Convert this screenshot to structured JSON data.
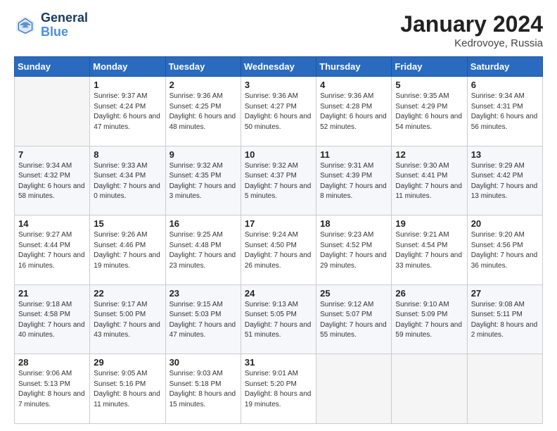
{
  "header": {
    "logo_line1": "General",
    "logo_line2": "Blue",
    "month_title": "January 2024",
    "location": "Kedrovoye, Russia"
  },
  "weekdays": [
    "Sunday",
    "Monday",
    "Tuesday",
    "Wednesday",
    "Thursday",
    "Friday",
    "Saturday"
  ],
  "weeks": [
    [
      {
        "day": "",
        "sunrise": "",
        "sunset": "",
        "daylight": ""
      },
      {
        "day": "1",
        "sunrise": "Sunrise: 9:37 AM",
        "sunset": "Sunset: 4:24 PM",
        "daylight": "Daylight: 6 hours and 47 minutes."
      },
      {
        "day": "2",
        "sunrise": "Sunrise: 9:36 AM",
        "sunset": "Sunset: 4:25 PM",
        "daylight": "Daylight: 6 hours and 48 minutes."
      },
      {
        "day": "3",
        "sunrise": "Sunrise: 9:36 AM",
        "sunset": "Sunset: 4:27 PM",
        "daylight": "Daylight: 6 hours and 50 minutes."
      },
      {
        "day": "4",
        "sunrise": "Sunrise: 9:36 AM",
        "sunset": "Sunset: 4:28 PM",
        "daylight": "Daylight: 6 hours and 52 minutes."
      },
      {
        "day": "5",
        "sunrise": "Sunrise: 9:35 AM",
        "sunset": "Sunset: 4:29 PM",
        "daylight": "Daylight: 6 hours and 54 minutes."
      },
      {
        "day": "6",
        "sunrise": "Sunrise: 9:34 AM",
        "sunset": "Sunset: 4:31 PM",
        "daylight": "Daylight: 6 hours and 56 minutes."
      }
    ],
    [
      {
        "day": "7",
        "sunrise": "Sunrise: 9:34 AM",
        "sunset": "Sunset: 4:32 PM",
        "daylight": "Daylight: 6 hours and 58 minutes."
      },
      {
        "day": "8",
        "sunrise": "Sunrise: 9:33 AM",
        "sunset": "Sunset: 4:34 PM",
        "daylight": "Daylight: 7 hours and 0 minutes."
      },
      {
        "day": "9",
        "sunrise": "Sunrise: 9:32 AM",
        "sunset": "Sunset: 4:35 PM",
        "daylight": "Daylight: 7 hours and 3 minutes."
      },
      {
        "day": "10",
        "sunrise": "Sunrise: 9:32 AM",
        "sunset": "Sunset: 4:37 PM",
        "daylight": "Daylight: 7 hours and 5 minutes."
      },
      {
        "day": "11",
        "sunrise": "Sunrise: 9:31 AM",
        "sunset": "Sunset: 4:39 PM",
        "daylight": "Daylight: 7 hours and 8 minutes."
      },
      {
        "day": "12",
        "sunrise": "Sunrise: 9:30 AM",
        "sunset": "Sunset: 4:41 PM",
        "daylight": "Daylight: 7 hours and 11 minutes."
      },
      {
        "day": "13",
        "sunrise": "Sunrise: 9:29 AM",
        "sunset": "Sunset: 4:42 PM",
        "daylight": "Daylight: 7 hours and 13 minutes."
      }
    ],
    [
      {
        "day": "14",
        "sunrise": "Sunrise: 9:27 AM",
        "sunset": "Sunset: 4:44 PM",
        "daylight": "Daylight: 7 hours and 16 minutes."
      },
      {
        "day": "15",
        "sunrise": "Sunrise: 9:26 AM",
        "sunset": "Sunset: 4:46 PM",
        "daylight": "Daylight: 7 hours and 19 minutes."
      },
      {
        "day": "16",
        "sunrise": "Sunrise: 9:25 AM",
        "sunset": "Sunset: 4:48 PM",
        "daylight": "Daylight: 7 hours and 23 minutes."
      },
      {
        "day": "17",
        "sunrise": "Sunrise: 9:24 AM",
        "sunset": "Sunset: 4:50 PM",
        "daylight": "Daylight: 7 hours and 26 minutes."
      },
      {
        "day": "18",
        "sunrise": "Sunrise: 9:23 AM",
        "sunset": "Sunset: 4:52 PM",
        "daylight": "Daylight: 7 hours and 29 minutes."
      },
      {
        "day": "19",
        "sunrise": "Sunrise: 9:21 AM",
        "sunset": "Sunset: 4:54 PM",
        "daylight": "Daylight: 7 hours and 33 minutes."
      },
      {
        "day": "20",
        "sunrise": "Sunrise: 9:20 AM",
        "sunset": "Sunset: 4:56 PM",
        "daylight": "Daylight: 7 hours and 36 minutes."
      }
    ],
    [
      {
        "day": "21",
        "sunrise": "Sunrise: 9:18 AM",
        "sunset": "Sunset: 4:58 PM",
        "daylight": "Daylight: 7 hours and 40 minutes."
      },
      {
        "day": "22",
        "sunrise": "Sunrise: 9:17 AM",
        "sunset": "Sunset: 5:00 PM",
        "daylight": "Daylight: 7 hours and 43 minutes."
      },
      {
        "day": "23",
        "sunrise": "Sunrise: 9:15 AM",
        "sunset": "Sunset: 5:03 PM",
        "daylight": "Daylight: 7 hours and 47 minutes."
      },
      {
        "day": "24",
        "sunrise": "Sunrise: 9:13 AM",
        "sunset": "Sunset: 5:05 PM",
        "daylight": "Daylight: 7 hours and 51 minutes."
      },
      {
        "day": "25",
        "sunrise": "Sunrise: 9:12 AM",
        "sunset": "Sunset: 5:07 PM",
        "daylight": "Daylight: 7 hours and 55 minutes."
      },
      {
        "day": "26",
        "sunrise": "Sunrise: 9:10 AM",
        "sunset": "Sunset: 5:09 PM",
        "daylight": "Daylight: 7 hours and 59 minutes."
      },
      {
        "day": "27",
        "sunrise": "Sunrise: 9:08 AM",
        "sunset": "Sunset: 5:11 PM",
        "daylight": "Daylight: 8 hours and 2 minutes."
      }
    ],
    [
      {
        "day": "28",
        "sunrise": "Sunrise: 9:06 AM",
        "sunset": "Sunset: 5:13 PM",
        "daylight": "Daylight: 8 hours and 7 minutes."
      },
      {
        "day": "29",
        "sunrise": "Sunrise: 9:05 AM",
        "sunset": "Sunset: 5:16 PM",
        "daylight": "Daylight: 8 hours and 11 minutes."
      },
      {
        "day": "30",
        "sunrise": "Sunrise: 9:03 AM",
        "sunset": "Sunset: 5:18 PM",
        "daylight": "Daylight: 8 hours and 15 minutes."
      },
      {
        "day": "31",
        "sunrise": "Sunrise: 9:01 AM",
        "sunset": "Sunset: 5:20 PM",
        "daylight": "Daylight: 8 hours and 19 minutes."
      },
      {
        "day": "",
        "sunrise": "",
        "sunset": "",
        "daylight": ""
      },
      {
        "day": "",
        "sunrise": "",
        "sunset": "",
        "daylight": ""
      },
      {
        "day": "",
        "sunrise": "",
        "sunset": "",
        "daylight": ""
      }
    ]
  ]
}
